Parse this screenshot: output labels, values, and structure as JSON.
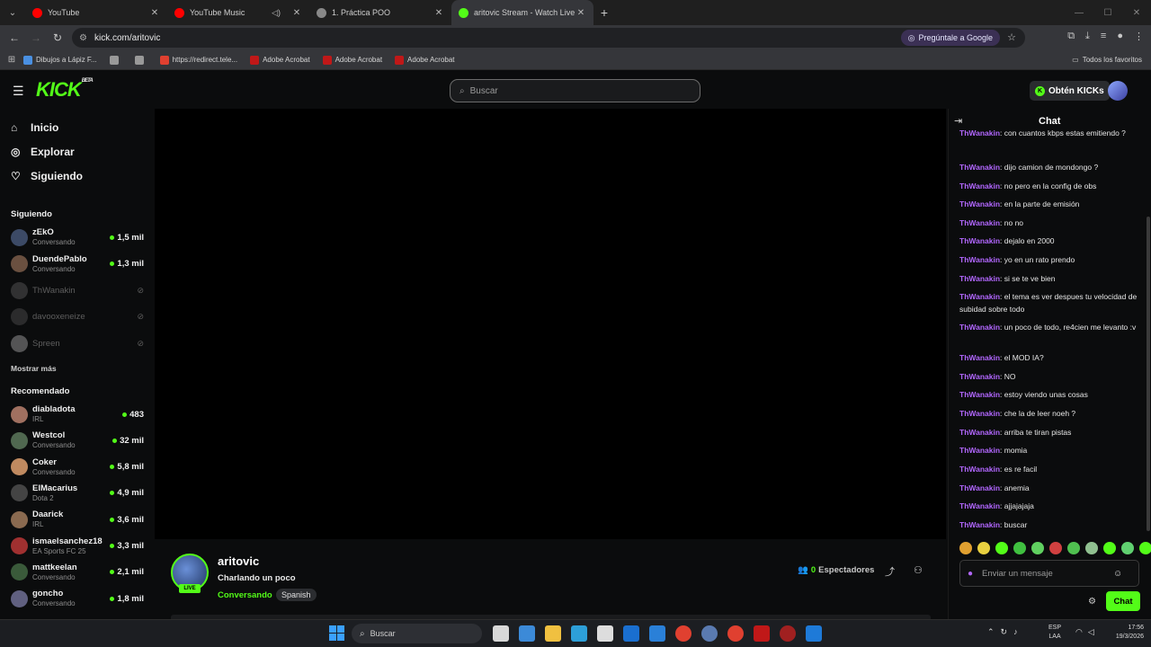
{
  "browser": {
    "tabs": [
      {
        "label": "YouTube",
        "color": "#ff0000",
        "active": false
      },
      {
        "label": "YouTube Music",
        "color": "#ff0000",
        "active": false
      },
      {
        "label": "1. Práctica POO",
        "color": "#888888",
        "active": false
      },
      {
        "label": "aritovic Stream - Watch Live on",
        "color": "#53fc18",
        "active": true
      }
    ],
    "url": "kick.com/aritovic",
    "gemini_label": "Pregúntale a Google",
    "bookmarks": [
      {
        "label": "Dibujos a Lápiz F...",
        "icon": "chrome-icon"
      },
      {
        "label": "",
        "icon": "globe-icon"
      },
      {
        "label": "",
        "icon": "globe-icon"
      },
      {
        "label": "https://redirect.tele...",
        "icon": "pdf-icon"
      },
      {
        "label": "Adobe Acrobat",
        "icon": "acrobat-icon"
      },
      {
        "label": "Adobe Acrobat",
        "icon": "acrobat-icon"
      },
      {
        "label": "Adobe Acrobat",
        "icon": "acrobat-icon"
      }
    ],
    "all_bookmarks": "Todos los favoritos"
  },
  "header": {
    "logo": "KICK",
    "logo_sup": "BETA",
    "search_placeholder": "Buscar",
    "kicks_button": "Obtén KICKs"
  },
  "sidebar": {
    "nav": [
      {
        "label": "Inicio",
        "icon": "home-icon"
      },
      {
        "label": "Explorar",
        "icon": "compass-icon"
      },
      {
        "label": "Siguiendo",
        "icon": "heart-icon"
      }
    ],
    "following_title": "Siguiendo",
    "following": [
      {
        "name": "zEkO",
        "category": "Conversando",
        "viewers": "1,5 mil",
        "live": true,
        "color": "#3c4a66"
      },
      {
        "name": "DuendePablo",
        "category": "Conversando",
        "viewers": "1,3 mil",
        "live": true,
        "color": "#6a5040"
      },
      {
        "name": "ThWanakin",
        "category": "",
        "viewers": "",
        "live": false,
        "color": "#777777"
      },
      {
        "name": "davooxeneize",
        "category": "",
        "viewers": "",
        "live": false,
        "color": "#666666"
      },
      {
        "name": "Spreen",
        "category": "",
        "viewers": "",
        "live": false,
        "color": "#dddddd"
      }
    ],
    "show_more": "Mostrar más",
    "recommended_title": "Recomendado",
    "recommended": [
      {
        "name": "diabladota",
        "category": "IRL",
        "viewers": "483",
        "color": "#a07060"
      },
      {
        "name": "Westcol",
        "category": "Conversando",
        "viewers": "32 mil",
        "color": "#506850"
      },
      {
        "name": "Coker",
        "category": "Conversando",
        "viewers": "5,8 mil",
        "color": "#c08a60"
      },
      {
        "name": "ElMacarius",
        "category": "Dota 2",
        "viewers": "4,9 mil",
        "color": "#444444"
      },
      {
        "name": "Daarick",
        "category": "IRL",
        "viewers": "3,6 mil",
        "color": "#8a6a50"
      },
      {
        "name": "ismaelsanchez18",
        "category": "EA Sports FC 25",
        "viewers": "3,3 mil",
        "color": "#a03030"
      },
      {
        "name": "mattkeelan",
        "category": "Conversando",
        "viewers": "2,1 mil",
        "color": "#3a5a3a"
      },
      {
        "name": "goncho",
        "category": "Conversando",
        "viewers": "1,8 mil",
        "color": "#606080"
      }
    ]
  },
  "stream": {
    "channel": "aritovic",
    "title": "Charlando un poco",
    "category": "Conversando",
    "language": "Spanish",
    "live_badge": "LIVE",
    "viewers": "0",
    "viewers_label": "Espectadores"
  },
  "chat": {
    "title": "Chat",
    "messages": [
      {
        "user": "ThWanakin",
        "text": "con cuantos kbps estas emitiendo ?"
      },
      {
        "user": "ThWanakin",
        "text": "dijo camion de mondongo ?"
      },
      {
        "user": "ThWanakin",
        "text": "no pero en la config de obs"
      },
      {
        "user": "ThWanakin",
        "text": "en la parte de emisión"
      },
      {
        "user": "ThWanakin",
        "text": "no no"
      },
      {
        "user": "ThWanakin",
        "text": "dejalo en 2000"
      },
      {
        "user": "ThWanakin",
        "text": "yo en un rato prendo"
      },
      {
        "user": "ThWanakin",
        "text": "si se te ve bien"
      },
      {
        "user": "ThWanakin",
        "text": "el tema es ver despues tu velocidad de subidad sobre todo"
      },
      {
        "user": "ThWanakin",
        "text": "un poco de todo, re4cien me levanto :v"
      },
      {
        "user": "ThWanakin",
        "text": "el MOD IA?"
      },
      {
        "user": "ThWanakin",
        "text": "NO"
      },
      {
        "user": "ThWanakin",
        "text": "estoy viendo unas cosas"
      },
      {
        "user": "ThWanakin",
        "text": "che la de leer noeh ?"
      },
      {
        "user": "ThWanakin",
        "text": "arriba te tiran pistas"
      },
      {
        "user": "ThWanakin",
        "text": "momia"
      },
      {
        "user": "ThWanakin",
        "text": "es re facil"
      },
      {
        "user": "ThWanakin",
        "text": "anemia"
      },
      {
        "user": "ThWanakin",
        "text": "ajjajajaja"
      },
      {
        "user": "ThWanakin",
        "text": "buscar"
      }
    ],
    "input_placeholder": "Enviar un mensaje",
    "send_button": "Chat"
  },
  "taskbar": {
    "search_label": "Buscar",
    "lang_top": "ESP",
    "lang_bottom": "LAA",
    "time": "17:56",
    "date": "19/3/2026"
  }
}
